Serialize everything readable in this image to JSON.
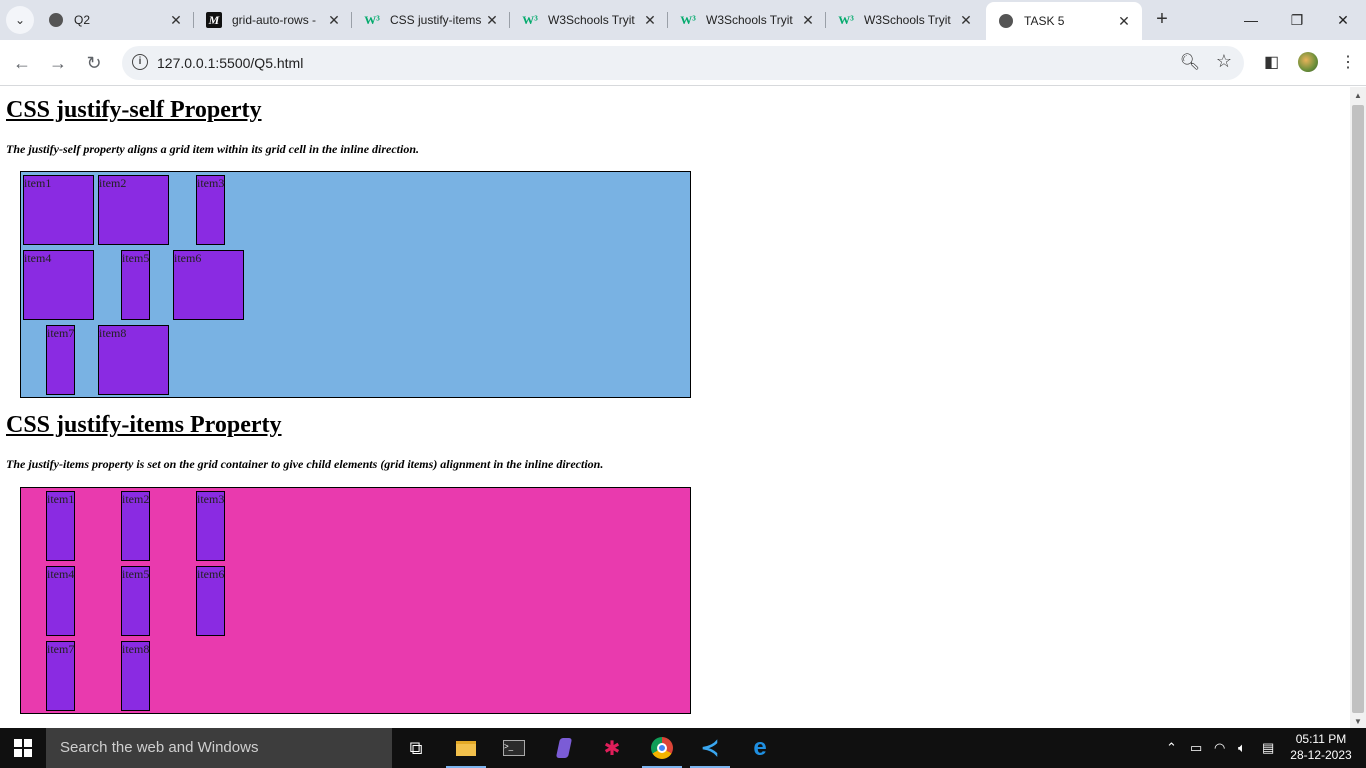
{
  "browser": {
    "tabs": [
      {
        "title": "Q2",
        "favicon": "globe-icon",
        "active": false
      },
      {
        "title": "grid-auto-rows -",
        "favicon": "m-icon",
        "active": false
      },
      {
        "title": "CSS justify-items",
        "favicon": "w3-icon",
        "active": false
      },
      {
        "title": "W3Schools Tryit",
        "favicon": "w3-icon",
        "active": false
      },
      {
        "title": "W3Schools Tryit",
        "favicon": "w3-icon",
        "active": false
      },
      {
        "title": "W3Schools Tryit",
        "favicon": "w3-icon",
        "active": false
      },
      {
        "title": "TASK 5",
        "favicon": "globe-icon",
        "active": true
      }
    ],
    "url": "127.0.0.1:5500/Q5.html"
  },
  "page": {
    "section1": {
      "heading": "CSS justify-self Property",
      "description": "The justify-self property aligns a grid item within its grid cell in the inline direction.",
      "items": [
        "item1",
        "item2",
        "item3",
        "item4",
        "item5",
        "item6",
        "item7",
        "item8"
      ],
      "background": "#79b2e3"
    },
    "section2": {
      "heading": "CSS justify-items Property",
      "description": "The justify-items property is set on the grid container to give child elements (grid items) alignment in the inline direction.",
      "items": [
        "item1",
        "item2",
        "item3",
        "item4",
        "item5",
        "item6",
        "item7",
        "item8"
      ],
      "background": "#e93aae"
    },
    "item_color": "#8a2be2"
  },
  "taskbar": {
    "search_placeholder": "Search the web and Windows",
    "time": "05:11 PM",
    "date": "28-12-2023"
  }
}
